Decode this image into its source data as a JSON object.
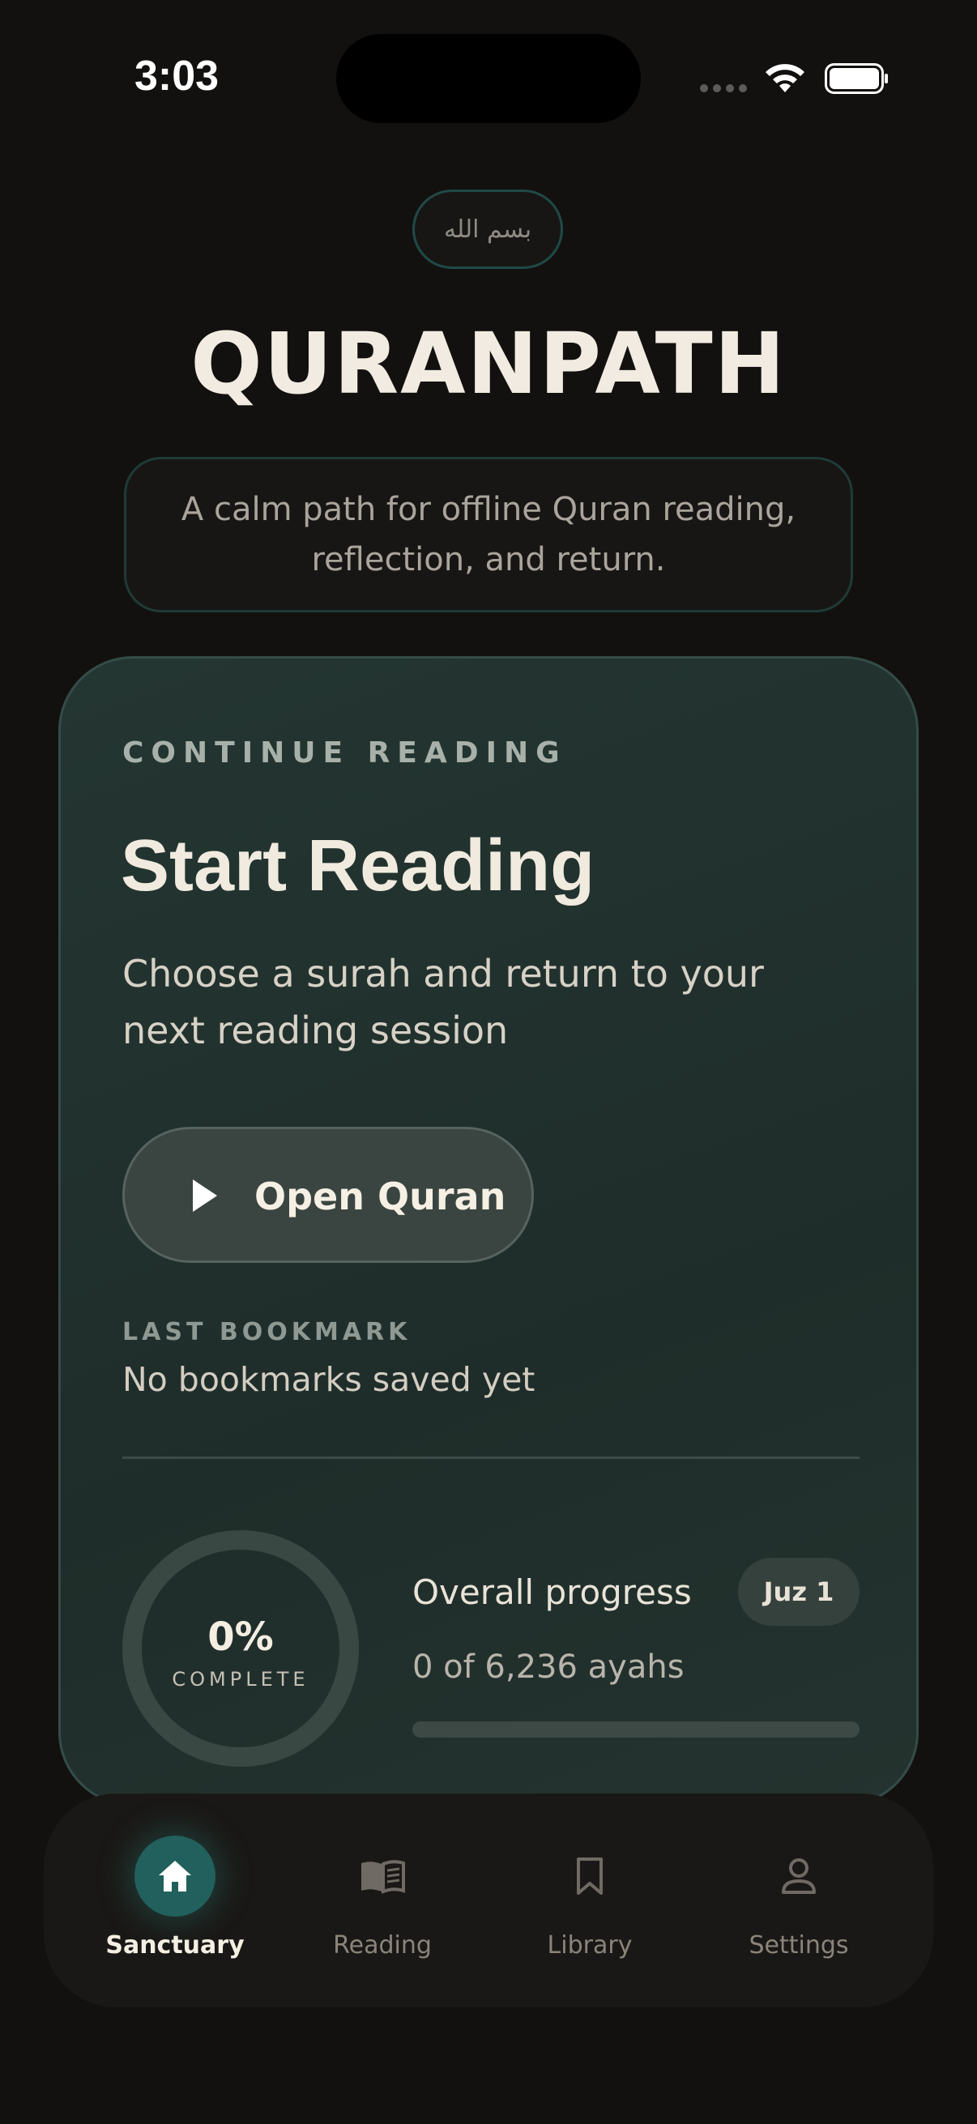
{
  "status_bar": {
    "time": "3:03"
  },
  "header": {
    "bismillah": "بسم الله",
    "title": "QURANPATH",
    "tagline": "A calm path for offline Quran reading, reflection, and return."
  },
  "continue_card": {
    "kicker": "CONTINUE READING",
    "title": "Start Reading",
    "subtitle": "Choose a surah and return to your next reading session",
    "button_label": "Open Quran",
    "bookmark_kicker": "LAST BOOKMARK",
    "bookmark_value": "No bookmarks saved yet",
    "progress": {
      "percent_text": "0%",
      "percent_label": "COMPLETE",
      "title": "Overall progress",
      "juz_badge": "Juz 1",
      "count_text": "0 of 6,236 ayahs",
      "fraction": 0
    }
  },
  "bottom_nav": {
    "items": [
      {
        "label": "Sanctuary",
        "icon": "home-icon",
        "active": true
      },
      {
        "label": "Reading",
        "icon": "open-book-icon",
        "active": false
      },
      {
        "label": "Library",
        "icon": "bookmark-icon",
        "active": false
      },
      {
        "label": "Settings",
        "icon": "person-icon",
        "active": false
      }
    ]
  },
  "colors": {
    "background": "#13110f",
    "accent": "#21605c",
    "card": "#24332f",
    "text_primary": "#f0eadf"
  }
}
